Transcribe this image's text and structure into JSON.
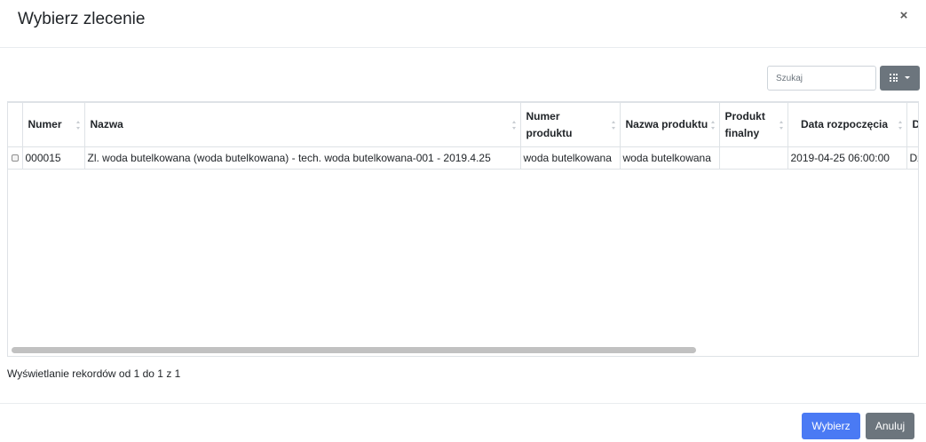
{
  "modal": {
    "title": "Wybierz zlecenie",
    "close_label": "×"
  },
  "toolbar": {
    "search_placeholder": "Szukaj",
    "columns_icon": "grid-icon"
  },
  "table": {
    "columns": [
      "Numer",
      "Nazwa",
      "Numer produktu",
      "Nazwa produktu",
      "Produkt finalny",
      "Data rozpoczęcia",
      "D"
    ],
    "rows": [
      {
        "numer": "000015",
        "nazwa": "Zl. woda butelkowana (woda butelkowana) - tech. woda butelkowana-001 - 2019.4.25",
        "numer_produktu": "woda butelkowana",
        "nazwa_produktu": "woda butelkowana",
        "produkt_finalny": "",
        "data_rozpoczecia": "2019-04-25 06:00:00",
        "d": "Dz"
      }
    ]
  },
  "records_info": "Wyświetlanie rekordów od 1 do 1 z 1",
  "footer": {
    "select_label": "Wybierz",
    "cancel_label": "Anuluj"
  },
  "colors": {
    "primary": "#4a7af4",
    "secondary": "#6c757d"
  }
}
